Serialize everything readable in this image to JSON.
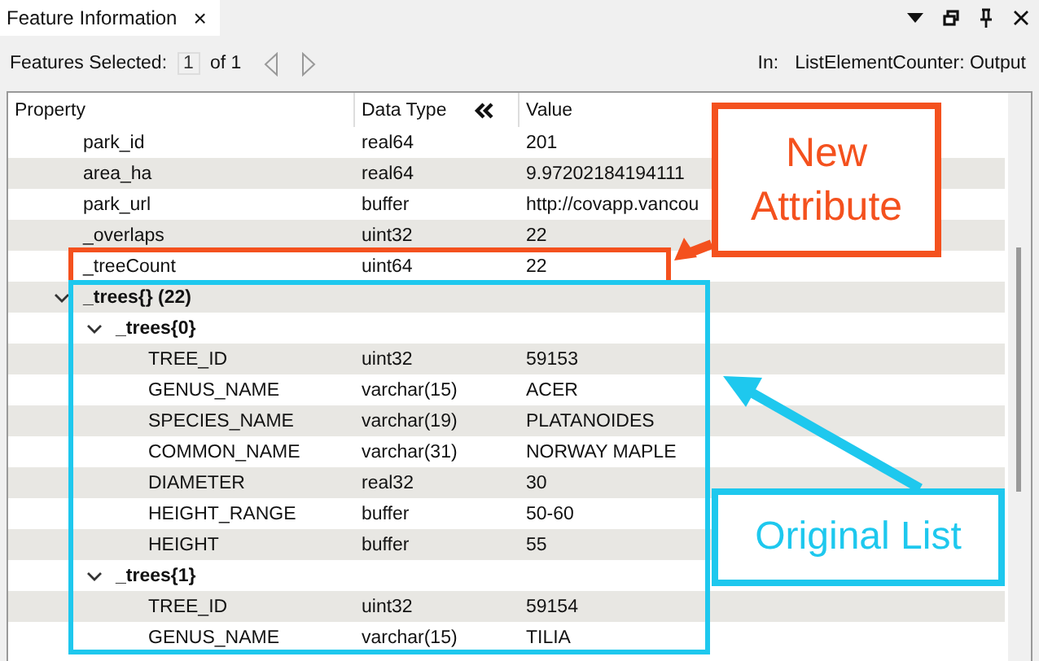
{
  "tab": {
    "title": "Feature Information",
    "close": "×"
  },
  "toolbar": {
    "label": "Features Selected:",
    "current": "1",
    "total": "of 1",
    "source_label": "In:",
    "source": "ListElementCounter: Output"
  },
  "table": {
    "columns": [
      "Property",
      "Data Type",
      "Value"
    ],
    "rows": [
      {
        "name": "park_id",
        "type": "real64",
        "value": "201"
      },
      {
        "name": "area_ha",
        "type": "real64",
        "value": "9.97202184194111"
      },
      {
        "name": "park_url",
        "type": "buffer",
        "value": "http://covapp.vancou"
      },
      {
        "name": "_overlaps",
        "type": "uint32",
        "value": "22"
      },
      {
        "name": "_treeCount",
        "type": "uint64",
        "value": "22"
      },
      {
        "name": "_trees{} (22)",
        "expanded": true,
        "children": [
          {
            "name": "_trees{0}",
            "expanded": true,
            "children": [
              {
                "name": "TREE_ID",
                "type": "uint32",
                "value": "59153"
              },
              {
                "name": "GENUS_NAME",
                "type": "varchar(15)",
                "value": "ACER"
              },
              {
                "name": "SPECIES_NAME",
                "type": "varchar(19)",
                "value": "PLATANOIDES"
              },
              {
                "name": "COMMON_NAME",
                "type": "varchar(31)",
                "value": "NORWAY MAPLE"
              },
              {
                "name": "DIAMETER",
                "type": "real32",
                "value": "30"
              },
              {
                "name": "HEIGHT_RANGE",
                "type": "buffer",
                "value": "50-60"
              },
              {
                "name": "HEIGHT",
                "type": "buffer",
                "value": "55"
              }
            ]
          },
          {
            "name": "_trees{1}",
            "expanded": true,
            "children": [
              {
                "name": "TREE_ID",
                "type": "uint32",
                "value": "59154"
              },
              {
                "name": "GENUS_NAME",
                "type": "varchar(15)",
                "value": "TILIA"
              }
            ]
          }
        ]
      }
    ]
  },
  "annotations": [
    {
      "text": "New Attribute",
      "color": "#f4511e"
    },
    {
      "text": "Original List",
      "color": "#1ec8ee"
    }
  ]
}
